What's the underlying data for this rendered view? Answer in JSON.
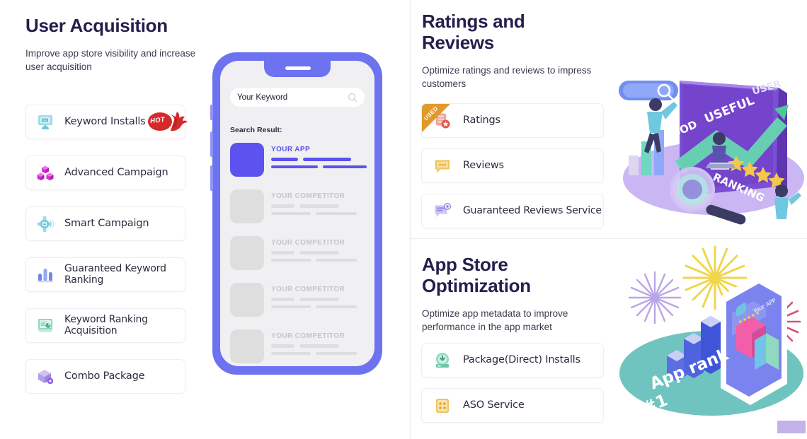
{
  "left_column": {
    "title": "User Acquisition",
    "subtitle": "Improve app store visibility and increase user acquisition",
    "items": [
      {
        "label": "Keyword Installs",
        "icon": "keyword-monitor-icon",
        "badge": "HOT",
        "badge_color": "#d42a2a"
      },
      {
        "label": "Advanced Campaign",
        "icon": "cubes-icon",
        "badge": null
      },
      {
        "label": "Smart Campaign",
        "icon": "smart-gear-icon",
        "badge": null
      },
      {
        "label": "Guaranteed Keyword Ranking",
        "icon": "bar-chart-icon",
        "badge": null
      },
      {
        "label": "Keyword Ranking Acquisition",
        "icon": "report-chart-icon",
        "badge": null
      },
      {
        "label": "Combo Package",
        "icon": "package-plus-icon",
        "badge": null
      }
    ]
  },
  "phone_mockup": {
    "search_value": "Your Keyword",
    "search_icon": "search-icon",
    "results_label": "Search Result:",
    "results": [
      {
        "name": "YOUR APP",
        "highlight": true
      },
      {
        "name": "YOUR COMPETITOR",
        "highlight": false
      },
      {
        "name": "YOUR COMPETITOR",
        "highlight": false
      },
      {
        "name": "YOUR COMPETITOR",
        "highlight": false
      },
      {
        "name": "YOUR COMPETITOR",
        "highlight": false
      }
    ]
  },
  "ratings_section": {
    "title": "Ratings and Reviews",
    "subtitle": "Optimize ratings and reviews to impress customers",
    "items": [
      {
        "label": "Ratings",
        "icon": "ratings-doc-icon",
        "badge": "USED",
        "badge_color": "#e09a2b"
      },
      {
        "label": "Reviews",
        "icon": "comment-bubble-icon",
        "badge": null
      },
      {
        "label": "Guaranteed Reviews Service",
        "icon": "review-badge-icon",
        "badge": null
      }
    ],
    "illustration": {
      "name": "ratings-ranking-illustration",
      "labels": [
        "USEFUL",
        "GOOD",
        "RANKING",
        "USER"
      ],
      "stars": 4
    }
  },
  "aso_section": {
    "title": "App Store Optimization",
    "subtitle": "Optimize app metadata to improve performance in the app market",
    "items": [
      {
        "label": "Package(Direct) Installs",
        "icon": "download-package-icon",
        "badge": null
      },
      {
        "label": "ASO Service",
        "icon": "grid-app-icon",
        "badge": null
      }
    ],
    "illustration": {
      "name": "app-rank-fireworks-illustration",
      "caption": "App rank #1",
      "phone_label": "Your APP"
    }
  },
  "theme": {
    "heading_color": "#231f4d",
    "body_text_color": "#3b3b4f",
    "card_border_color": "#eeeef3",
    "accent_indigo": "#5b52f0",
    "phone_frame": "#6c72f0",
    "hot_red": "#d42a2a",
    "used_orange": "#e09a2b"
  }
}
